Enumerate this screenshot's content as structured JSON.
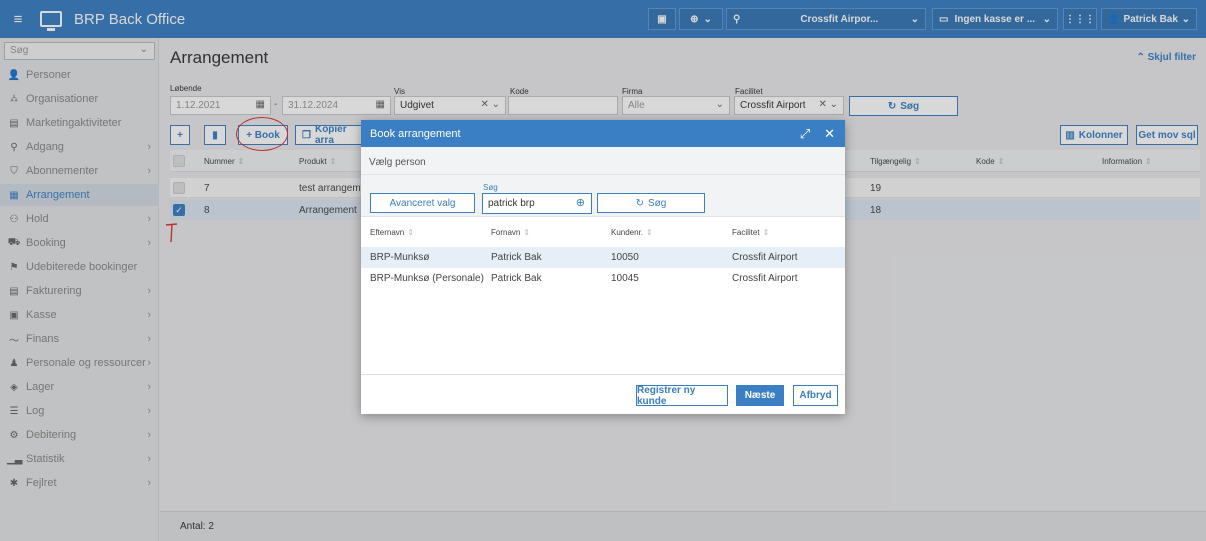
{
  "app": {
    "title": "BRP Back Office"
  },
  "topbar": {
    "location": "Crossfit Airpor...",
    "register": "Ingen kasse er ...",
    "user": "Patrick Bak"
  },
  "sidebar": {
    "search_placeholder": "Søg",
    "items": [
      {
        "label": "Personer",
        "icon": "person-icon"
      },
      {
        "label": "Organisationer",
        "icon": "org-icon"
      },
      {
        "label": "Marketingaktiviteter",
        "icon": "marketing-icon"
      },
      {
        "label": "Adgang",
        "icon": "key-icon"
      },
      {
        "label": "Abonnementer",
        "icon": "shield-icon"
      },
      {
        "label": "Arrangement",
        "icon": "calendar-icon"
      },
      {
        "label": "Hold",
        "icon": "group-icon"
      },
      {
        "label": "Booking",
        "icon": "cart-icon"
      },
      {
        "label": "Udebiterede bookinger",
        "icon": "flag-icon"
      },
      {
        "label": "Fakturering",
        "icon": "invoice-icon"
      },
      {
        "label": "Kasse",
        "icon": "register-icon"
      },
      {
        "label": "Finans",
        "icon": "chart-line-icon"
      },
      {
        "label": "Personale og ressourcer",
        "icon": "staff-icon"
      },
      {
        "label": "Lager",
        "icon": "stock-icon"
      },
      {
        "label": "Log",
        "icon": "list-icon"
      },
      {
        "label": "Debitering",
        "icon": "debit-icon"
      },
      {
        "label": "Statistik",
        "icon": "bar-chart-icon"
      },
      {
        "label": "Fejlret",
        "icon": "bug-icon"
      }
    ]
  },
  "page": {
    "title": "Arrangement",
    "hide_filter": "Skjul filter",
    "filters": {
      "lobende_label": "Løbende",
      "date_from": "1.12.2021",
      "date_to": "31.12.2024",
      "vis_label": "Vis",
      "vis_value": "Udgivet",
      "kode_label": "Kode",
      "firma_label": "Firma",
      "firma_value": "Alle",
      "facilitet_label": "Facilitet",
      "facilitet_value": "Crossfit Airport",
      "search_button": "Søg"
    },
    "toolbar": {
      "book_label": "+ Book",
      "copy_label": "Kopier arra",
      "columns_label": "Kolonner",
      "get_sql_label": "Get mov sql"
    },
    "table": {
      "headers": {
        "nummer": "Nummer",
        "produkt": "Produkt",
        "tilgaengelig": "Tilgængelig",
        "kode": "Kode",
        "information": "Information"
      },
      "rows": [
        {
          "nummer": "7",
          "produkt": "test arrangemen",
          "tilgaengelig": "19"
        },
        {
          "nummer": "8",
          "produkt": "Arrangement",
          "tilgaengelig": "18"
        }
      ]
    },
    "footer": "Antal:  2"
  },
  "modal": {
    "title": "Book arrangement",
    "subtitle": "Vælg person",
    "advanced_button": "Avanceret valg",
    "search_label": "Søg",
    "search_value": "patrick brp",
    "search_button": "Søg",
    "headers": {
      "efternavn": "Efternavn",
      "fornavn": "Fornavn",
      "kundenr": "Kundenr.",
      "facilitet": "Facilitet"
    },
    "rows": [
      {
        "efternavn": "BRP-Munksø",
        "fornavn": "Patrick Bak",
        "kundenr": "10050",
        "facilitet": "Crossfit Airport"
      },
      {
        "efternavn": "BRP-Munksø (Personale)",
        "fornavn": "Patrick Bak",
        "kundenr": "10045",
        "facilitet": "Crossfit Airport"
      }
    ],
    "register_button": "Registrer ny kunde",
    "next_button": "Næste",
    "cancel_button": "Afbryd"
  },
  "colors": {
    "accent": "#3a7fc4",
    "annotation": "#dd3333"
  }
}
